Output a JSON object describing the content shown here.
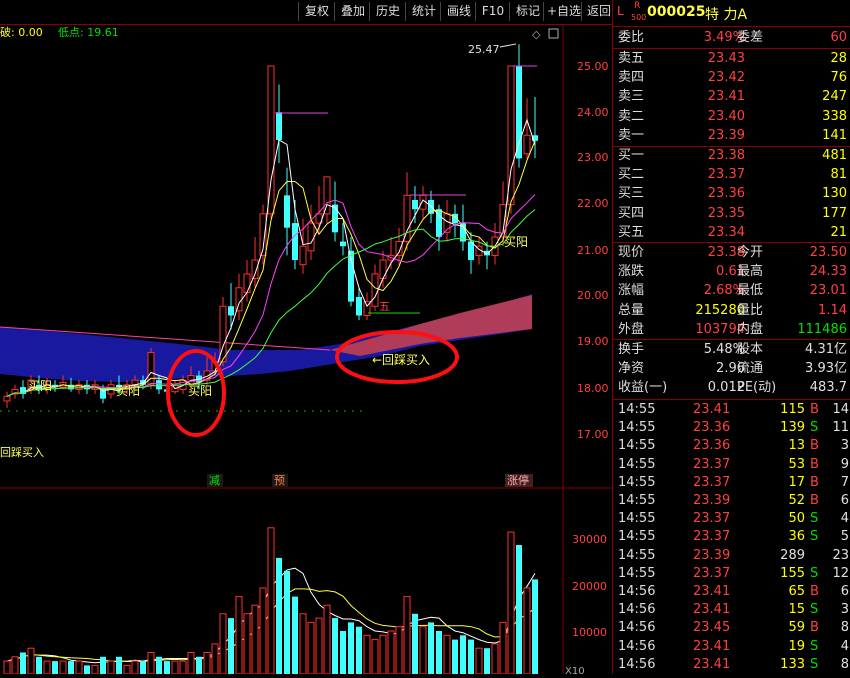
{
  "toolbar": {
    "items": [
      "复权",
      "叠加",
      "历史",
      "统计",
      "画线",
      "F10",
      "标记",
      "+自选",
      "返回"
    ]
  },
  "chart": {
    "header_break": "破: 0.00",
    "header_low": "低点: 19.61",
    "max_label": "25.47",
    "y_ticks": [
      "25.00",
      "24.00",
      "23.00",
      "22.00",
      "21.00",
      "20.00",
      "19.00",
      "18.00",
      "17.00"
    ],
    "vol_ticks": [
      "30000",
      "20000",
      "10000"
    ],
    "vol_unit": "X10",
    "ann_buy_yang_1": "买阳",
    "ann_buy_yang_2": "买阳",
    "ann_buy_yang_3": "买阳",
    "ann_buy_yang_4": "买阳",
    "ann_pullback_buy": "←回踩买入",
    "ann_pullback_left": "回踩买入",
    "ann_five": "五",
    "marker_jian": "减",
    "marker_yu": "预",
    "marker_zhangting": "涨停"
  },
  "quote": {
    "l_badge": "L",
    "r_badge": "R",
    "five_hundred": "500",
    "code": "000025",
    "name": "特 力A",
    "weibi_label": "委比",
    "weibi": "3.49%",
    "weicha_label": "委差",
    "weicha": "60",
    "sell": [
      {
        "label": "卖五",
        "price": "23.43",
        "vol": "28"
      },
      {
        "label": "卖四",
        "price": "23.42",
        "vol": "76"
      },
      {
        "label": "卖三",
        "price": "23.41",
        "vol": "247"
      },
      {
        "label": "卖二",
        "price": "23.40",
        "vol": "338"
      },
      {
        "label": "卖一",
        "price": "23.39",
        "vol": "141"
      }
    ],
    "buy": [
      {
        "label": "买一",
        "price": "23.38",
        "vol": "481"
      },
      {
        "label": "买二",
        "price": "23.37",
        "vol": "81"
      },
      {
        "label": "买三",
        "price": "23.36",
        "vol": "130"
      },
      {
        "label": "买四",
        "price": "23.35",
        "vol": "177"
      },
      {
        "label": "买五",
        "price": "23.34",
        "vol": "21"
      }
    ],
    "stats": [
      {
        "l1": "现价",
        "v1": "23.38",
        "l2": "今开",
        "v2": "23.50"
      },
      {
        "l1": "涨跌",
        "v1": "0.61",
        "l2": "最高",
        "v2": "24.33"
      },
      {
        "l1": "涨幅",
        "v1": "2.68%",
        "l2": "最低",
        "v2": "23.01"
      },
      {
        "l1": "总量",
        "v1": "215280",
        "l2": "量比",
        "v2": "1.14"
      },
      {
        "l1": "外盘",
        "v1": "103794",
        "l2": "内盘",
        "v2": "111486"
      }
    ],
    "fund": [
      {
        "l1": "换手",
        "v1": "5.48%",
        "l2": "股本",
        "v2": "4.31亿"
      },
      {
        "l1": "净资",
        "v1": "2.96",
        "l2": "流通",
        "v2": "3.93亿"
      },
      {
        "l1": "收益(一)",
        "v1": "0.012",
        "l2": "PE(动)",
        "v2": "483.7"
      }
    ],
    "ticks": [
      {
        "t": "14:55",
        "p": "23.41",
        "v": "115",
        "s": "B",
        "c": "14"
      },
      {
        "t": "14:55",
        "p": "23.36",
        "v": "139",
        "s": "S",
        "c": "11"
      },
      {
        "t": "14:55",
        "p": "23.36",
        "v": "13",
        "s": "B",
        "c": "3"
      },
      {
        "t": "14:55",
        "p": "23.37",
        "v": "53",
        "s": "B",
        "c": "9"
      },
      {
        "t": "14:55",
        "p": "23.37",
        "v": "17",
        "s": "B",
        "c": "7"
      },
      {
        "t": "14:55",
        "p": "23.39",
        "v": "52",
        "s": "B",
        "c": "6"
      },
      {
        "t": "14:55",
        "p": "23.37",
        "v": "50",
        "s": "S",
        "c": "4"
      },
      {
        "t": "14:55",
        "p": "23.37",
        "v": "36",
        "s": "S",
        "c": "5"
      },
      {
        "t": "14:55",
        "p": "23.39",
        "v": "289",
        "s": "",
        "c": "23"
      },
      {
        "t": "14:55",
        "p": "23.37",
        "v": "155",
        "s": "S",
        "c": "12"
      },
      {
        "t": "14:56",
        "p": "23.41",
        "v": "65",
        "s": "B",
        "c": "6"
      },
      {
        "t": "14:56",
        "p": "23.41",
        "v": "15",
        "s": "S",
        "c": "3"
      },
      {
        "t": "14:56",
        "p": "23.45",
        "v": "59",
        "s": "B",
        "c": "8"
      },
      {
        "t": "14:56",
        "p": "23.41",
        "v": "19",
        "s": "S",
        "c": "4"
      },
      {
        "t": "14:56",
        "p": "23.41",
        "v": "133",
        "s": "S",
        "c": "8"
      }
    ]
  }
}
